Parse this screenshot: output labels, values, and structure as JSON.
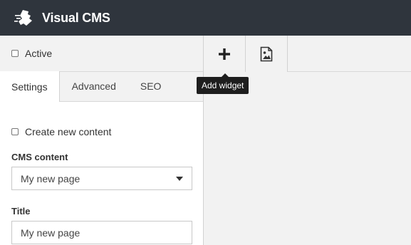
{
  "header": {
    "title": "Visual CMS",
    "logo_icon": "puzzle-logo-icon"
  },
  "sidebar": {
    "active_label": "Active",
    "tabs": [
      {
        "label": "Settings"
      },
      {
        "label": "Advanced"
      },
      {
        "label": "SEO"
      }
    ],
    "form": {
      "create_new_label": "Create new content",
      "cms_content_label": "CMS content",
      "cms_content_value": "My new page",
      "title_label": "Title",
      "title_value": "My new page"
    }
  },
  "toolbar": {
    "add_widget_tooltip": "Add widget",
    "add_icon": "plus-icon",
    "image_icon": "image-file-icon"
  },
  "colors": {
    "header_bg": "#2f353d",
    "panel_bg": "#f2f2f2"
  }
}
